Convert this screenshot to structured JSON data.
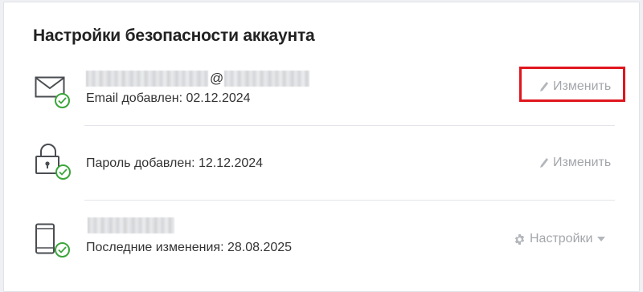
{
  "section": {
    "title": "Настройки безопасности аккаунта"
  },
  "rows": [
    {
      "kind": "email",
      "value_visible": "@",
      "status": "Email добавлен: 02.12.2024",
      "action": "Изменить"
    },
    {
      "kind": "password",
      "status": "Пароль добавлен: 12.12.2024",
      "action": "Изменить"
    },
    {
      "kind": "phone",
      "status": "Последние изменения: 28.08.2025",
      "action": "Настройки"
    }
  ],
  "icons": {
    "email": "envelope-icon",
    "password": "padlock-icon",
    "phone": "smartphone-icon",
    "verified": "check-circle-icon",
    "edit": "pencil-icon",
    "settings": "gear-icon",
    "dropdown": "caret-down-icon"
  },
  "colors": {
    "verified": "#3aa53a",
    "highlight": "#e0161e",
    "action_text": "#a3a6ab"
  }
}
